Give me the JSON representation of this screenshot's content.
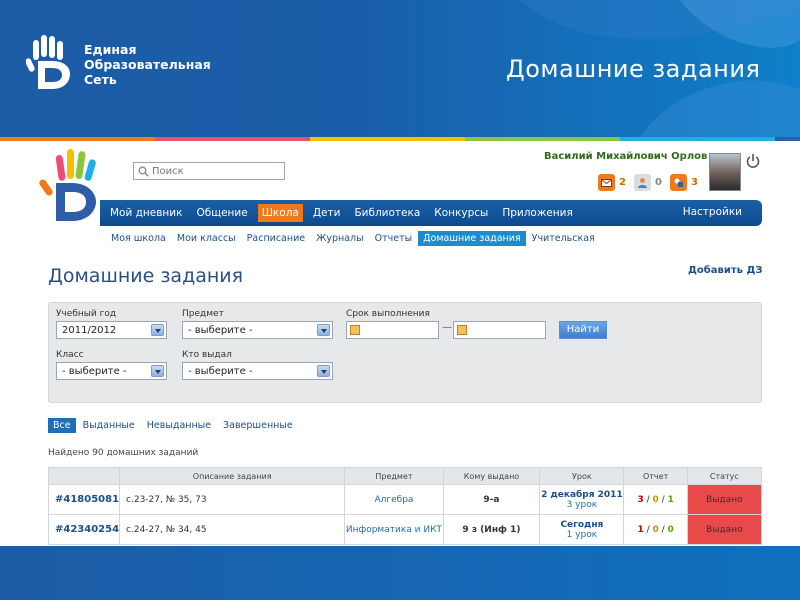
{
  "slide": {
    "brand_line1": "Единая",
    "brand_line2": "Образовательная",
    "brand_line3": "Сеть",
    "title": "Домашние задания",
    "stripe_colors": [
      "#f07a1a",
      "#e94e77",
      "#f2c200",
      "#8cc63f",
      "#1db0e6",
      "#2f5da8"
    ]
  },
  "app": {
    "search": {
      "placeholder": "Поиск"
    },
    "user": {
      "name": "Василий Михайлович Орлов"
    },
    "counters": [
      {
        "icon": "mail-icon",
        "value": "2",
        "color": "#f07a1a"
      },
      {
        "icon": "people-icon",
        "value": "0",
        "color": "#d8dde2"
      },
      {
        "icon": "tasks-icon",
        "value": "3",
        "color": "#f07a1a"
      }
    ],
    "main_nav": {
      "items": [
        "Мой дневник",
        "Общение",
        "Школа",
        "Дети",
        "Библиотека",
        "Конкурсы",
        "Приложения"
      ],
      "active": "Школа",
      "settings": "Настройки"
    },
    "sub_nav": {
      "items": [
        "Моя школа",
        "Мои классы",
        "Расписание",
        "Журналы",
        "Отчеты",
        "Домашние задания",
        "Учительская"
      ],
      "active": "Домашние задания"
    },
    "page": {
      "title": "Домашние задания",
      "add_link": "Добавить ДЗ"
    },
    "filters": {
      "year_label": "Учебный год",
      "year_value": "2011/2012",
      "subject_label": "Предмет",
      "subject_value": "- выберите -",
      "deadline_label": "Срок выполнения",
      "find_button": "Найти",
      "class_label": "Класс",
      "class_value": "- выберите -",
      "issuer_label": "Кто выдал",
      "issuer_value": "- выберите -"
    },
    "tabs": {
      "items": [
        "Все",
        "Выданные",
        "Невыданные",
        "Завершенные"
      ],
      "active": "Все"
    },
    "found_text": "Найдено 90 домашних заданий",
    "table": {
      "headers": [
        "",
        "Описание задания",
        "Предмет",
        "Кому выдано",
        "Урок",
        "Отчет",
        "Статус"
      ],
      "rows": [
        {
          "id": "#41805081",
          "description": "с.23-27, № 35, 73",
          "subject": "Алгебра",
          "class": "9-а",
          "lesson_date": "2 декабря 2011",
          "lesson_num": "3 урок",
          "report": [
            "3",
            "0",
            "1"
          ],
          "status": "Выдано"
        },
        {
          "id": "#42340254",
          "description": "с.24-27, № 34, 45",
          "subject": "Информатика и ИКТ",
          "class": "9 з (Инф 1)",
          "lesson_date": "Сегодня",
          "lesson_num": "1 урок",
          "report": [
            "1",
            "0",
            "0"
          ],
          "status": "Выдано"
        }
      ]
    }
  }
}
